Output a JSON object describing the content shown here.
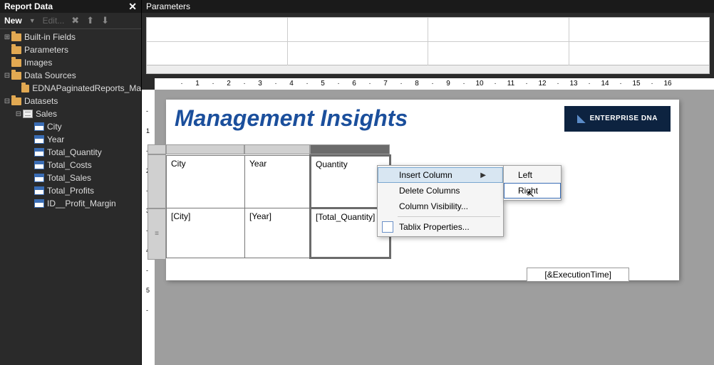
{
  "sidebar": {
    "title": "Report Data",
    "toolbar": {
      "new_label": "New",
      "edit_label": "Edit..."
    },
    "tree": [
      {
        "level": 0,
        "toggle": "+",
        "icon": "folder",
        "label": "Built-in Fields"
      },
      {
        "level": 0,
        "toggle": "",
        "icon": "folder",
        "label": "Parameters"
      },
      {
        "level": 0,
        "toggle": "",
        "icon": "folder",
        "label": "Images"
      },
      {
        "level": 0,
        "toggle": "-",
        "icon": "folder",
        "label": "Data Sources"
      },
      {
        "level": 1,
        "toggle": "",
        "icon": "folder",
        "label": "EDNAPaginatedReports_Ma"
      },
      {
        "level": 0,
        "toggle": "-",
        "icon": "folder",
        "label": "Datasets"
      },
      {
        "level": 1,
        "toggle": "-",
        "icon": "dataset",
        "label": "Sales"
      },
      {
        "level": 2,
        "toggle": "",
        "icon": "field",
        "label": "City"
      },
      {
        "level": 2,
        "toggle": "",
        "icon": "field",
        "label": "Year"
      },
      {
        "level": 2,
        "toggle": "",
        "icon": "field",
        "label": "Total_Quantity"
      },
      {
        "level": 2,
        "toggle": "",
        "icon": "field",
        "label": "Total_Costs"
      },
      {
        "level": 2,
        "toggle": "",
        "icon": "field",
        "label": "Total_Sales"
      },
      {
        "level": 2,
        "toggle": "",
        "icon": "field",
        "label": "Total_Profits"
      },
      {
        "level": 2,
        "toggle": "",
        "icon": "field",
        "label": "ID__Profit_Margin"
      }
    ]
  },
  "parameters_panel": {
    "title": "Parameters"
  },
  "ruler_h": {
    "marks": [
      1,
      2,
      3,
      4,
      5,
      6,
      7,
      8,
      9,
      10,
      11,
      12,
      13,
      14,
      15,
      16
    ]
  },
  "ruler_v": {
    "marks": [
      "-",
      "1",
      "-",
      "2",
      "-",
      "3",
      "-",
      "4",
      "-",
      "5",
      "-"
    ]
  },
  "report": {
    "title": "Management Insights",
    "logo_text": "ENTERPRISE DNA",
    "footer_expr": "[&ExecutionTime]"
  },
  "tablix": {
    "columns": [
      "City",
      "Year",
      "Quantity"
    ],
    "data_row": [
      "[City]",
      "[Year]",
      "[Total_Quantity]"
    ],
    "selected_col_index": 2
  },
  "context_menu": {
    "items": [
      {
        "label": "Insert Column",
        "has_sub": true,
        "hover": true
      },
      {
        "label": "Delete Columns"
      },
      {
        "label": "Column Visibility..."
      },
      {
        "sep": true
      },
      {
        "label": "Tablix Properties...",
        "icon": true
      }
    ],
    "submenu": [
      {
        "label": "Left"
      },
      {
        "label": "Right",
        "selected": true
      }
    ]
  }
}
